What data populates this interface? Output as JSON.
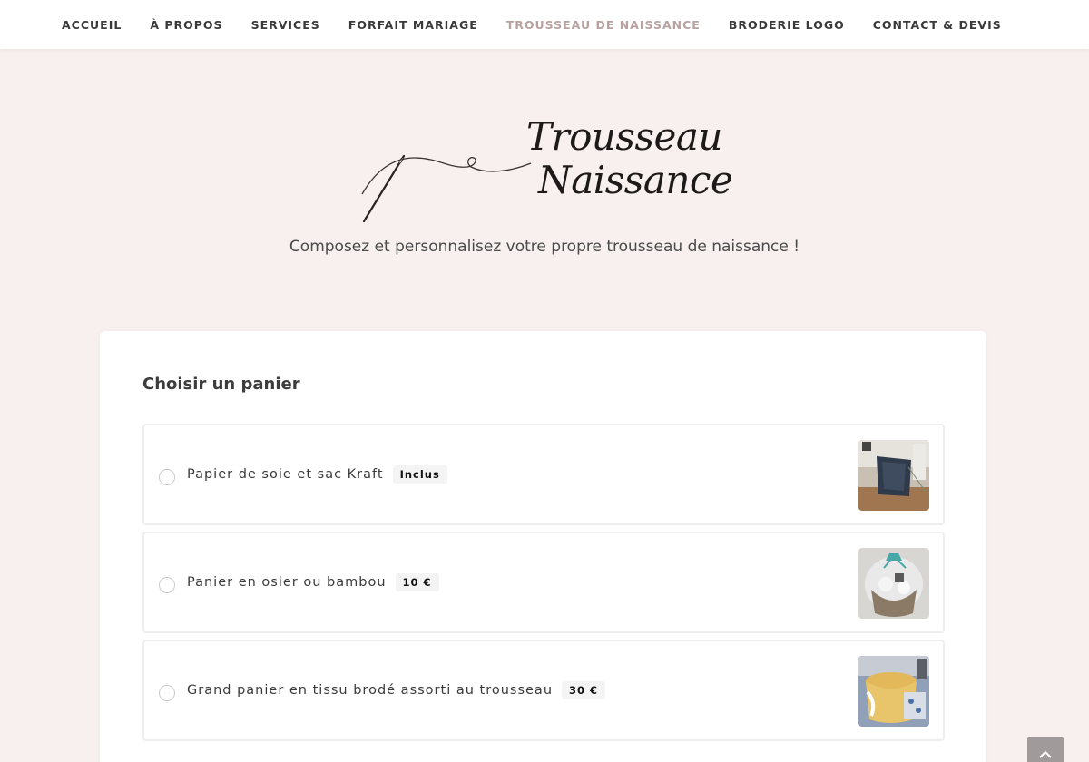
{
  "nav": {
    "items": [
      {
        "label": "ACCUEIL",
        "active": false
      },
      {
        "label": "À PROPOS",
        "active": false
      },
      {
        "label": "SERVICES",
        "active": false
      },
      {
        "label": "FORFAIT MARIAGE",
        "active": false
      },
      {
        "label": "TROUSSEAU DE NAISSANCE",
        "active": true
      },
      {
        "label": "BRODERIE LOGO",
        "active": false
      },
      {
        "label": "CONTACT & DEVIS",
        "active": false
      }
    ],
    "active_color": "#b8a2a0"
  },
  "hero": {
    "logo_line1": "Trousseau",
    "logo_line2": "Naissance",
    "logo_icon": "needle-and-thread-icon",
    "tagline": "Composez et personnalisez votre propre trousseau de naissance !"
  },
  "basket": {
    "title": "Choisir un panier",
    "options": [
      {
        "label": "Papier de soie et sac Kraft",
        "price": "Inclus",
        "image": "tissue-paper-kraft-bag-photo",
        "selected": false
      },
      {
        "label": "Panier en osier ou bambou",
        "price": "10 €",
        "image": "wicker-basket-photo",
        "selected": false
      },
      {
        "label": "Grand panier en tissu brodé assorti au trousseau",
        "price": "30 €",
        "image": "embroidered-fabric-basket-photo",
        "selected": false
      }
    ]
  },
  "colors": {
    "background": "#f7f0ef",
    "card": "#ffffff",
    "text": "#3a3a3a"
  },
  "back_to_top": {
    "icon": "chevron-up-icon"
  }
}
